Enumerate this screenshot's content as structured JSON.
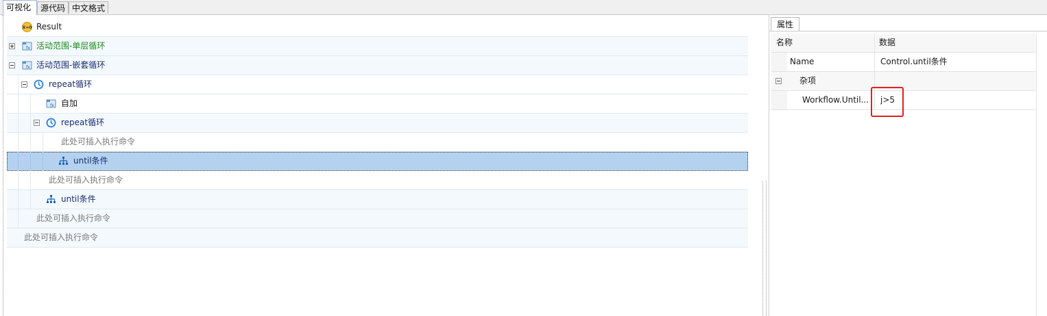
{
  "tabs": [
    {
      "label": "可视化",
      "active": true
    },
    {
      "label": "源代码",
      "active": false
    },
    {
      "label": "中文格式",
      "active": false
    }
  ],
  "tree": {
    "rows": [
      {
        "label": "Result"
      },
      {
        "label": "活动范围-单层循环"
      },
      {
        "label": "活动范围-嵌套循环"
      },
      {
        "label": "repeat循环"
      },
      {
        "label": "自加"
      },
      {
        "label": "repeat循环"
      },
      {
        "label": "此处可插入执行命令"
      },
      {
        "label": "until条件"
      },
      {
        "label": "此处可插入执行命令"
      },
      {
        "label": "until条件"
      },
      {
        "label": "此处可插入执行命令"
      },
      {
        "label": "此处可插入执行命令"
      }
    ]
  },
  "properties": {
    "tab_label": "属性",
    "header": {
      "name": "名称",
      "value": "数据"
    },
    "rows": [
      {
        "name": "Name",
        "value": "Control.until条件"
      },
      {
        "name": "杂项",
        "value": ""
      },
      {
        "name": "Workflow.Until...",
        "value": "j>5"
      }
    ]
  },
  "colors": {
    "selected_row": "#b4d2ef",
    "green_text": "#1a8a1a",
    "navy_text": "#1a2c6e",
    "highlight_box": "#e0201f"
  }
}
